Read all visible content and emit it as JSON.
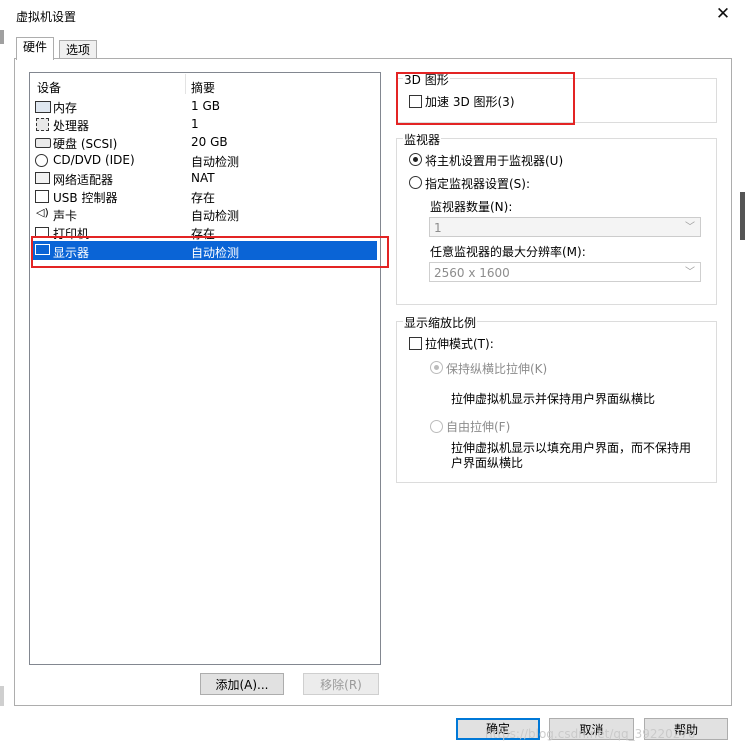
{
  "window": {
    "title": "虚拟机设置"
  },
  "tabs": [
    {
      "label": "硬件"
    },
    {
      "label": "选项"
    }
  ],
  "device_list": {
    "headers": {
      "device": "设备",
      "summary": "摘要"
    },
    "rows": [
      {
        "icon": "memory-icon",
        "device": "内存",
        "summary": "1 GB"
      },
      {
        "icon": "processor-icon",
        "device": "处理器",
        "summary": "1"
      },
      {
        "icon": "hard-disk-icon",
        "device": "硬盘 (SCSI)",
        "summary": "20 GB"
      },
      {
        "icon": "cd-dvd-icon",
        "device": "CD/DVD (IDE)",
        "summary": "自动检测"
      },
      {
        "icon": "network-adapter-icon",
        "device": "网络适配器",
        "summary": "NAT"
      },
      {
        "icon": "usb-icon",
        "device": "USB 控制器",
        "summary": "存在"
      },
      {
        "icon": "sound-card-icon",
        "device": "声卡",
        "summary": "自动检测"
      },
      {
        "icon": "printer-icon",
        "device": "打印机",
        "summary": "存在"
      },
      {
        "icon": "display-icon",
        "device": "显示器",
        "summary": "自动检测",
        "selected": true
      }
    ]
  },
  "buttons": {
    "add": "添加(A)...",
    "remove": "移除(R)",
    "ok": "确定",
    "cancel": "取消",
    "help": "帮助"
  },
  "graphics_3d": {
    "title": "3D 图形",
    "accelerate_label": "加速 3D 图形(3)",
    "checked": false
  },
  "monitors": {
    "title": "监视器",
    "option_host": "将主机设置用于监视器(U)",
    "option_specify": "指定监视器设置(S):",
    "selected": "host",
    "count_label": "监视器数量(N):",
    "count_value": "1",
    "resolution_label": "任意监视器的最大分辨率(M):",
    "resolution_value": "2560 x 1600"
  },
  "display_scaling": {
    "title": "显示缩放比例",
    "stretch_label": "拉伸模式(T):",
    "stretch_checked": false,
    "keep_aspect_label": "保持纵横比拉伸(K)",
    "keep_aspect_desc": "拉伸虚拟机显示并保持用户界面纵横比",
    "free_stretch_label": "自由拉伸(F)",
    "free_stretch_desc": "拉伸虚拟机显示以填充用户界面，而不保持用户界面纵横比"
  },
  "watermark": "https://blog.csdn.net/qq_39220270",
  "colors": {
    "selection": "#0a64d6",
    "annotation_red": "#e32424",
    "default_button_border": "#0078d7"
  }
}
